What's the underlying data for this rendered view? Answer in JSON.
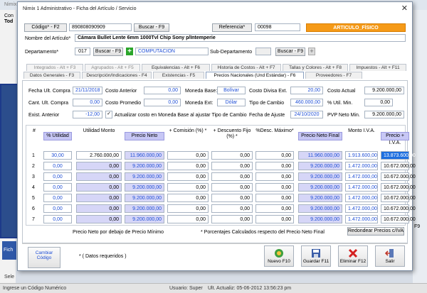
{
  "window": {
    "title": "Nimix 1 Administrativo - Ficha del Artículo / Servicio"
  },
  "background": {
    "title": "Nimix",
    "left_label_1": "Con",
    "left_label_2": "Tod",
    "right_label_f9": "F9",
    "ficha_label": "Fich",
    "select_label": "Sele",
    "status_hint": "Ingrese un Código Numérico",
    "status_user": "Usuario: Super",
    "status_last": "Ult. Actualiz: 05-06-2012 13:56:23 pm"
  },
  "header": {
    "codigo_label": "Código* - F2",
    "codigo_value": "890808090909",
    "buscar_f9": "Buscar - F9",
    "referencia_label": "Referencia*",
    "referencia_value": "00098",
    "tipo_badge": "ARTICULO_FÍSICO",
    "nombre_label": "Nombre del Artículo*",
    "nombre_value": "Cámara Bullet Lente 6mm 1000Tvl Chip Sony p/Intemperie",
    "depto_label": "Departamento*",
    "depto_code": "017",
    "depto_buscar": "Buscar - F9",
    "depto_name": "COMPUTACION",
    "subdepto_label": "Sub-Departamento",
    "subdepto_buscar": "Buscar - F9"
  },
  "tabs": [
    {
      "label": "Integrados - Alt + F3",
      "state": "dim"
    },
    {
      "label": "Agrupados - Alt + F5",
      "state": "dim"
    },
    {
      "label": "Equivalencias - Alt + F6",
      "state": "normal"
    },
    {
      "label": "Historia de Costos - Alt + F7",
      "state": "normal"
    },
    {
      "label": "Tallas y Colores - Alt + F8",
      "state": "normal"
    },
    {
      "label": "Impuestos - Alt + F11",
      "state": "normal"
    },
    {
      "label": "Datos Generales - F3",
      "state": "normal"
    },
    {
      "label": "Descripción/Indicaciones - F4",
      "state": "normal"
    },
    {
      "label": "Existencias - F5",
      "state": "normal"
    },
    {
      "label": "Precios Nacionales (Und Estándar) - F6",
      "state": "active"
    },
    {
      "label": "Proveedores - F7",
      "state": "normal"
    }
  ],
  "costs": {
    "fecha_ult_compra_label": "Fecha Ult. Compra",
    "fecha_ult_compra": "21/11/2018",
    "costo_anterior_label": "Costo Anterior",
    "costo_anterior": "0,00",
    "moneda_base_label": "Moneda Base:",
    "moneda_base": "Bolívar",
    "costo_divisa_label": "Costo Divisa Ext.",
    "costo_divisa": "20,00",
    "costo_actual_label": "Costo Actual",
    "costo_actual": "9.200.000,00",
    "cant_ult_compra_label": "Cant. Ult. Compra",
    "cant_ult_compra": "0,00",
    "costo_promedio_label": "Costo Promedio",
    "costo_promedio": "0,00",
    "moneda_ext_label": "Moneda Ext:",
    "moneda_ext": "Dólar",
    "tipo_cambio_label": "Tipo de Cambio",
    "tipo_cambio": "460.000,00",
    "util_min_label": "% Util. Min.",
    "util_min": "0,00",
    "exist_anterior_label": "Exist. Anterior",
    "exist_anterior": "-12,00",
    "actualizar_label": "Actualizar costo en Moneda Base al ajustar Tipo de Cambio",
    "actualizar_checked": "✓",
    "fecha_ajuste_label": "Fecha de Ajuste",
    "fecha_ajuste": "24/10/2020",
    "pvp_neto_min_label": "PVP Neto Min.",
    "pvp_neto_min": "9.200.000,00"
  },
  "table": {
    "headers": [
      "#",
      "% Utilidad",
      "Utilidad Monto",
      "Precio Neto",
      "+ Comisión (%) *",
      "+ Descuento Fijo (%) *",
      "%Desc. Máximo*",
      "Precio Neto Final",
      "Monto I.V.A.",
      "Precio + I.V.A."
    ],
    "rows": [
      [
        "1",
        "30,00",
        "2.760.000,00",
        "11.960.000,00",
        "0,00",
        "0,00",
        "0,00",
        "11.960.000,00",
        "1.913.600,00",
        "13.873.600,00"
      ],
      [
        "2",
        "0,00",
        "0,00",
        "9.200.000,00",
        "0,00",
        "0,00",
        "0,00",
        "9.200.000,00",
        "1.472.000,00",
        "10.672.000,00"
      ],
      [
        "3",
        "0,00",
        "0,00",
        "9.200.000,00",
        "0,00",
        "0,00",
        "0,00",
        "9.200.000,00",
        "1.472.000,00",
        "10.672.000,00"
      ],
      [
        "4",
        "0,00",
        "0,00",
        "9.200.000,00",
        "0,00",
        "0,00",
        "0,00",
        "9.200.000,00",
        "1.472.000,00",
        "10.672.000,00"
      ],
      [
        "5",
        "0,00",
        "0,00",
        "9.200.000,00",
        "0,00",
        "0,00",
        "0,00",
        "9.200.000,00",
        "1.472.000,00",
        "10.672.000,00"
      ],
      [
        "6",
        "0,00",
        "0,00",
        "9.200.000,00",
        "0,00",
        "0,00",
        "0,00",
        "9.200.000,00",
        "1.472.000,00",
        "10.672.000,00"
      ],
      [
        "7",
        "0,00",
        "0,00",
        "9.200.000,00",
        "0,00",
        "0,00",
        "0,00",
        "9.200.000,00",
        "1.472.000,00",
        "10.672.000,00"
      ]
    ]
  },
  "notes": {
    "precio_min_note": "Precio Neto por debajo de Precio Mínimo",
    "porcentajes_note": "* Porcentajes Calculados respecto del Precio Neto Final",
    "redondear_button": "Redondear Precios c/IVA"
  },
  "footer": {
    "cambiar_codigo": "Cambiar Código",
    "datos_requeridos": "* ( Datos requeridos )",
    "nuevo": "Nuevo F10",
    "guardar": "Guardar F11",
    "eliminar": "Eliminar F12",
    "salir": "Salir"
  },
  "colors": {
    "accent_orange": "#f59a18",
    "header_highlight": "#c7c7f5",
    "selection_blue": "#1d6fe0",
    "link_blue": "#1f4fd6"
  }
}
